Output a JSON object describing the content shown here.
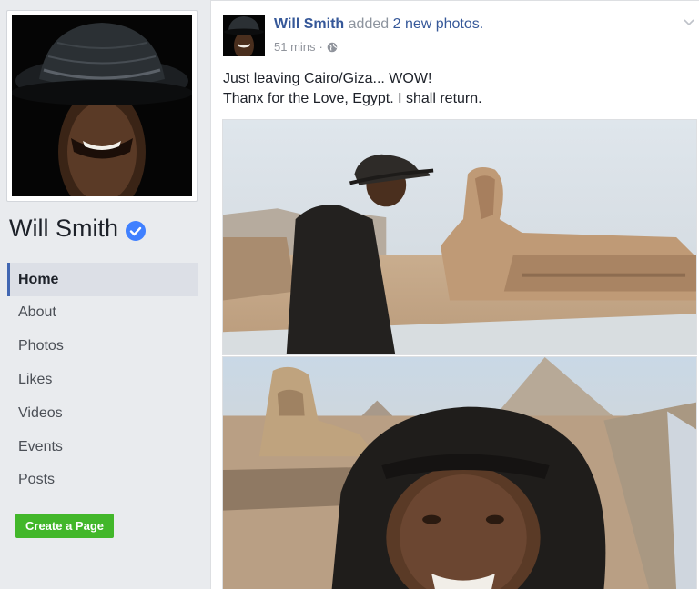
{
  "sidebar": {
    "page_name": "Will Smith",
    "nav": [
      {
        "label": "Home",
        "active": true
      },
      {
        "label": "About"
      },
      {
        "label": "Photos"
      },
      {
        "label": "Likes"
      },
      {
        "label": "Videos"
      },
      {
        "label": "Events"
      },
      {
        "label": "Posts"
      }
    ],
    "create_page_label": "Create a Page"
  },
  "post": {
    "author": "Will Smith",
    "action": "added",
    "photo_count": "2 new photos.",
    "time": "51 mins",
    "separator": "·",
    "text_line1": "Just leaving Cairo/Giza... WOW!",
    "text_line2": "Thanx for the Love, Egypt. I shall return."
  },
  "colors": {
    "link_blue": "#365899",
    "accent_blue": "#4267b2",
    "create_green": "#42b72a",
    "verified_blue": "#4080ff"
  },
  "icons": {
    "verified": "verified-badge-icon",
    "privacy": "globe-icon",
    "menu": "chevron-down-icon"
  }
}
